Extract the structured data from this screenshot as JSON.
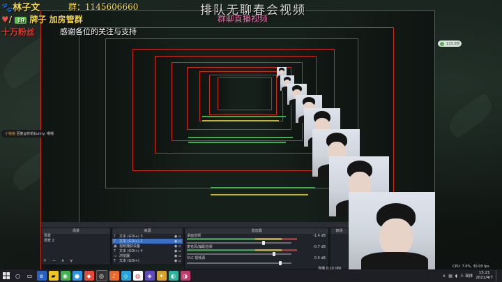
{
  "overlay": {
    "streamer_name": "林子文",
    "qq_group": "群：1145606660",
    "fan_badge": "19",
    "fan_text": "牌子 加房管群",
    "wan_text": "十万粉丝",
    "thanks_text": "感谢各位的关注与支持",
    "title_main": "排队无聊春会视频",
    "title_sub": "群聊直播视频"
  },
  "chat": {
    "user": "小猪猪",
    "message": "回复@你的bunny: 嗯嗯"
  },
  "fans_pill": "133.3粉",
  "obs": {
    "scenes_header": "场景",
    "scenes": [
      "场景",
      "场景 2"
    ],
    "sources_header": "来源",
    "sources": [
      {
        "icon": "T",
        "label": "文本 (GDI+) 3"
      },
      {
        "icon": "T",
        "label": "文本 (GDI+) 2"
      },
      {
        "icon": "▣",
        "label": "视频捕获设备"
      },
      {
        "icon": "T",
        "label": "文本 (GDI+) 4"
      },
      {
        "icon": "▭",
        "label": "浏览器"
      },
      {
        "icon": "T",
        "label": "文本 (GDI+)"
      }
    ],
    "mixer_header": "混音器",
    "mixer": [
      {
        "label": "桌面音频",
        "db": "-1.4 dB",
        "level": 0.72
      },
      {
        "label": "麦克风/辅助音频",
        "db": "-0.7 dB",
        "level": 0.82
      },
      {
        "label": "VLC 视频源",
        "db": "0.0 dB",
        "level": 0.88
      }
    ],
    "transitions_header": "转场",
    "footer_controls": "+ − ∧ ∨",
    "status": "直播 0:10 (IN)",
    "cpu_status": "CPU: 7.0%, 30.00 fps"
  },
  "taskbar": {
    "ime": "人 简体",
    "time": "15:21",
    "date": "2021/4/7",
    "icons": [
      "start",
      "search",
      "task-view",
      "browser",
      "wechat",
      "qq",
      "obs",
      "folder",
      "chrome",
      "music",
      "app",
      "app2",
      "app3",
      "app4",
      "app5"
    ]
  },
  "colors": {
    "frame_border": "#d6281f",
    "overlay_gold": "#f5d84a",
    "overlay_red": "#e23b2d",
    "title_pink": "#f06fb0",
    "selection": "#3b6fc4"
  }
}
